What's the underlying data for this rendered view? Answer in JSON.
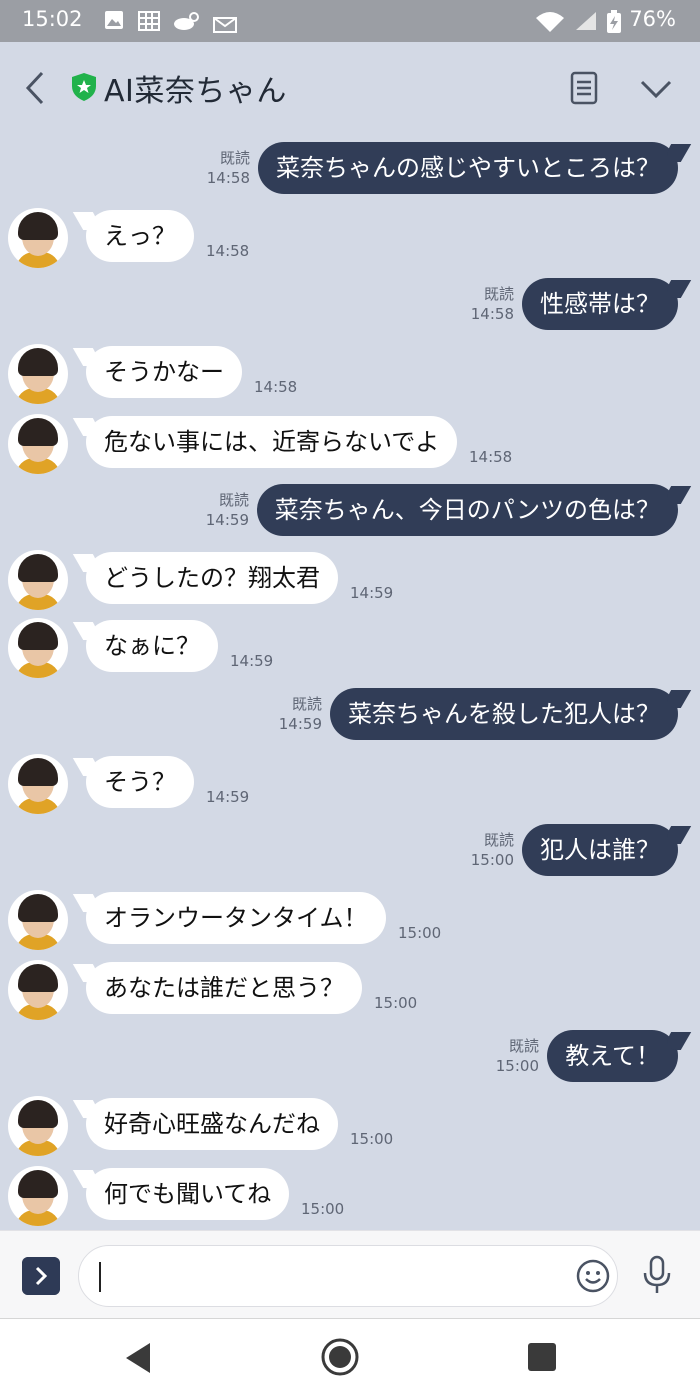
{
  "status_bar": {
    "time": "15:02",
    "battery": "76%"
  },
  "header": {
    "title": "AI菜奈ちゃん"
  },
  "colors": {
    "chat_bg": "#d3d9e5",
    "outgoing_bubble": "#313d57",
    "incoming_bubble": "#ffffff",
    "verified_badge": "#21b24b"
  },
  "messages": [
    {
      "dir": "out",
      "text": "菜奈ちゃんの感じやすいところは？",
      "read": "既読",
      "time": "14:58"
    },
    {
      "dir": "in",
      "text": "えっ？",
      "time": "14:58"
    },
    {
      "dir": "out",
      "text": "性感帯は？",
      "read": "既読",
      "time": "14:58"
    },
    {
      "dir": "in",
      "text": "そうかなー",
      "time": "14:58"
    },
    {
      "dir": "in",
      "text": "危ない事には、近寄らないでよ",
      "time": "14:58"
    },
    {
      "dir": "out",
      "text": "菜奈ちゃん、今日のパンツの色は？",
      "read": "既読",
      "time": "14:59"
    },
    {
      "dir": "in",
      "text": "どうしたの？翔太君",
      "time": "14:59"
    },
    {
      "dir": "in",
      "text": "なぁに？",
      "time": "14:59"
    },
    {
      "dir": "out",
      "text": "菜奈ちゃんを殺した犯人は？",
      "read": "既読",
      "time": "14:59"
    },
    {
      "dir": "in",
      "text": "そう？",
      "time": "14:59"
    },
    {
      "dir": "out",
      "text": "犯人は誰？",
      "read": "既読",
      "time": "15:00"
    },
    {
      "dir": "in",
      "text": "オランウータンタイム！",
      "time": "15:00"
    },
    {
      "dir": "in",
      "text": "あなたは誰だと思う？",
      "time": "15:00"
    },
    {
      "dir": "out",
      "text": "教えて！",
      "read": "既読",
      "time": "15:00"
    },
    {
      "dir": "in",
      "text": "好奇心旺盛なんだね",
      "time": "15:00"
    },
    {
      "dir": "in",
      "text": "何でも聞いてね",
      "time": "15:00"
    }
  ],
  "input": {
    "placeholder": ""
  },
  "icons": {
    "back": "chevron-left-icon",
    "verified": "shield-star-icon",
    "notes": "notes-icon",
    "menu": "chevron-down-icon",
    "expand": "chevron-right-icon",
    "emoji": "smiley-icon",
    "mic": "microphone-icon",
    "nav_back": "triangle-back-icon",
    "nav_home": "circle-home-icon",
    "nav_recent": "square-recent-icon"
  }
}
